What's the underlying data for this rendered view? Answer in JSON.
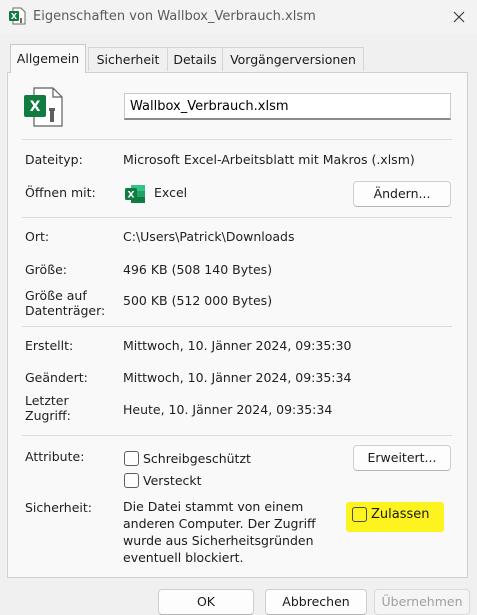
{
  "window": {
    "title": "Eigenschaften von Wallbox_Verbrauch.xlsm"
  },
  "tabs": [
    {
      "label": "Allgemein",
      "active": true
    },
    {
      "label": "Sicherheit",
      "active": false
    },
    {
      "label": "Details",
      "active": false
    },
    {
      "label": "Vorgängerversionen",
      "active": false
    }
  ],
  "general": {
    "file_name": "Wallbox_Verbrauch.xlsm",
    "file_type_label": "Dateityp:",
    "file_type_value": "Microsoft Excel-Arbeitsblatt mit Makros (.xlsm)",
    "opens_with_label": "Öffnen mit:",
    "opens_with_value": "Excel",
    "change_button": "Ändern...",
    "location_label": "Ort:",
    "location_value": "C:\\Users\\Patrick\\Downloads",
    "size_label": "Größe:",
    "size_value": "496 KB (508 140 Bytes)",
    "size_on_disk_label_1": "Größe auf",
    "size_on_disk_label_2": "Datenträger:",
    "size_on_disk_value": "500 KB (512 000 Bytes)",
    "created_label": "Erstellt:",
    "created_value": "Mittwoch, 10. Jänner 2024, 09:35:30",
    "modified_label": "Geändert:",
    "modified_value": "Mittwoch, 10. Jänner 2024, 09:35:34",
    "accessed_label_1": "Letzter",
    "accessed_label_2": "Zugriff:",
    "accessed_value": "Heute, 10. Jänner 2024, 09:35:34",
    "attributes_label": "Attribute:",
    "readonly_label": "Schreibgeschützt",
    "readonly_checked": false,
    "hidden_label": "Versteckt",
    "hidden_checked": false,
    "advanced_button": "Erweitert...",
    "security_label": "Sicherheit:",
    "security_text": "Die Datei stammt von einem anderen Computer. Der Zugriff wurde aus Sicherheitsgründen eventuell blockiert.",
    "unblock_label": "Zulassen",
    "unblock_checked": false,
    "highlight_color": "#fcf31f"
  },
  "footer": {
    "ok": "OK",
    "cancel": "Abbrechen",
    "apply": "Übernehmen"
  },
  "colors": {
    "excel_green": "#107c41",
    "panel_bg": "#f9f9f9",
    "window_bg": "#f0f0f0"
  },
  "icons": {
    "title": "excel-macro-file-icon",
    "file": "excel-macro-file-icon",
    "app": "excel-app-icon",
    "close": "close-icon"
  }
}
